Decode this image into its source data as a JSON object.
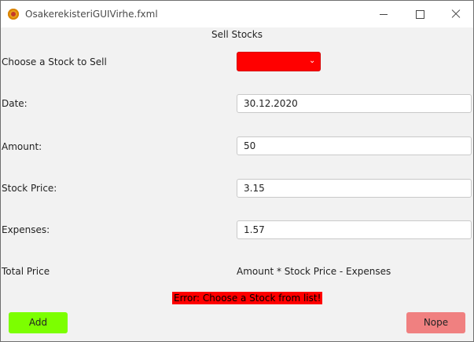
{
  "window": {
    "title": "OsakerekisteriGUIVirhe.fxml",
    "icons": {
      "app": "app-icon",
      "minimize": "minimize-icon",
      "maximize": "maximize-icon",
      "close": "close-icon"
    }
  },
  "form": {
    "heading": "Sell Stocks",
    "stock_label": "Choose a Stock to Sell",
    "stock_value": "",
    "date_label": "Date:",
    "date_value": "30.12.2020",
    "amount_label": "Amount:",
    "amount_value": "50",
    "price_label": "Stock Price:",
    "price_value": "3.15",
    "expenses_label": "Expenses:",
    "expenses_value": "1.57",
    "total_label": "Total Price",
    "total_formula": "Amount * Stock Price - Expenses",
    "error": "Error: Choose a Stock from list!"
  },
  "buttons": {
    "add": "Add",
    "nope": "Nope"
  },
  "colors": {
    "combo_error": "#ff0000",
    "error_bg": "#ff0000",
    "add_bg": "#7cff00",
    "nope_bg": "#f08080",
    "window_bg": "#f2f2f2"
  }
}
